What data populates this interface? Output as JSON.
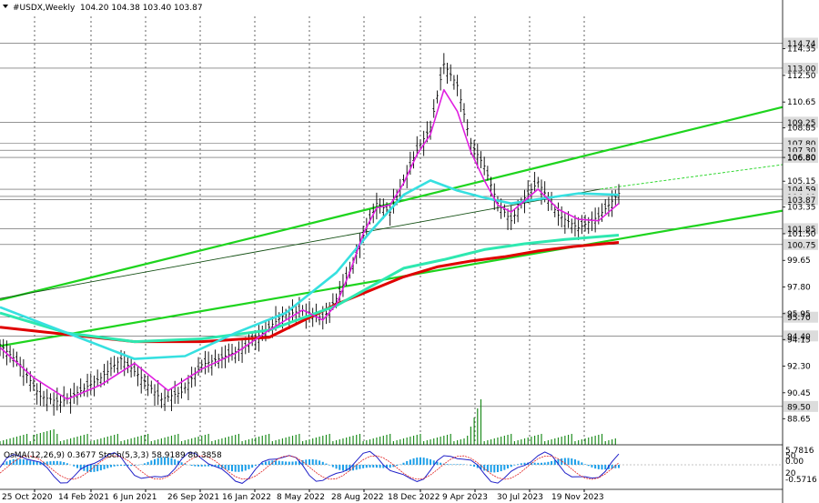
{
  "header": {
    "symbol": "#USDX,Weekly",
    "ohlc": "104.20 104.38 103.40 103.87"
  },
  "indicator": {
    "label": "OsMA(12,26,9) 0.3677  Stoch(5,3,3) 58.9189 80.3858",
    "axis_labels": [
      "5.7816",
      "50",
      "0.00",
      "20",
      "-0.5716"
    ]
  },
  "chart_data": {
    "type": "line",
    "title": "",
    "ylim": [
      86.9,
      116.6
    ],
    "y_ticks": [
      88.65,
      90.45,
      92.3,
      94.15,
      95.95,
      97.8,
      99.65,
      101.5,
      103.35,
      105.15,
      106.8,
      108.85,
      110.65,
      112.5,
      114.35
    ],
    "x_dates": [
      "25 Oct 2020",
      "14 Feb 2021",
      "6 Jun 2021",
      "26 Sep 2021",
      "16 Jan 2022",
      "8 May 2022",
      "28 Aug 2022",
      "18 Dec 2022",
      "9 Apr 2023",
      "30 Jul 2023",
      "19 Nov 2023"
    ],
    "levels": [
      {
        "value": 114.74,
        "label": "114.74"
      },
      {
        "value": 113.0,
        "label": "113.00"
      },
      {
        "value": 109.25,
        "label": "109.25"
      },
      {
        "value": 107.8,
        "label": "107.80"
      },
      {
        "value": 107.3,
        "label": "107.30"
      },
      {
        "value": 106.8,
        "label": "106.80"
      },
      {
        "value": 104.59,
        "label": "104.59"
      },
      {
        "value": 104.09,
        "label": "104.09"
      },
      {
        "value": 103.87,
        "label": "103.87"
      },
      {
        "value": 101.85,
        "label": "101.85"
      },
      {
        "value": 100.75,
        "label": "100.75"
      },
      {
        "value": 95.7,
        "label": "95.70"
      },
      {
        "value": 94.4,
        "label": "94.40"
      },
      {
        "value": 89.5,
        "label": "89.50"
      }
    ],
    "price": {
      "name": "#USDX",
      "x": [
        0,
        6,
        12,
        18,
        24,
        30,
        36,
        42,
        48,
        54,
        60,
        66,
        72,
        78,
        84,
        90,
        96,
        100,
        104,
        108,
        112,
        116,
        120,
        124,
        128,
        132,
        136,
        140,
        144,
        148,
        152,
        156,
        160,
        166,
        172,
        178,
        184
      ],
      "y": [
        93.8,
        92.4,
        90.2,
        89.8,
        90.6,
        91.5,
        92.8,
        91.5,
        90.0,
        90.5,
        92.4,
        92.9,
        93.5,
        94.6,
        95.8,
        96.2,
        95.6,
        97.0,
        98.9,
        101.4,
        103.6,
        103.0,
        105.2,
        107.3,
        108.9,
        113.3,
        111.8,
        107.8,
        106.2,
        103.6,
        102.4,
        104.0,
        105.1,
        102.8,
        101.9,
        102.7,
        104.3
      ]
    },
    "ma_magenta": {
      "x": [
        0,
        10,
        20,
        30,
        40,
        50,
        60,
        70,
        80,
        90,
        96,
        100,
        104,
        108,
        112,
        116,
        120,
        124,
        128,
        132,
        136,
        140,
        144,
        148,
        152,
        156,
        160,
        166,
        172,
        178,
        184
      ],
      "y": [
        93.6,
        91.5,
        90.0,
        91.0,
        92.5,
        90.6,
        92.1,
        93.2,
        94.8,
        96.2,
        95.5,
        96.6,
        98.8,
        101.5,
        103.3,
        103.5,
        105.0,
        107.0,
        108.4,
        111.5,
        110.0,
        107.2,
        105.2,
        103.5,
        103.0,
        103.8,
        104.6,
        103.2,
        102.5,
        102.4,
        103.6
      ]
    },
    "ma_cyan": {
      "x": [
        0,
        20,
        40,
        55,
        70,
        85,
        100,
        110,
        120,
        128,
        136,
        144,
        152,
        160,
        172,
        184
      ],
      "y": [
        96.4,
        94.6,
        92.8,
        93.0,
        94.6,
        96.0,
        98.8,
        101.6,
        104.2,
        105.2,
        104.5,
        104.0,
        103.6,
        103.9,
        104.3,
        104.2
      ]
    },
    "ma_teal": {
      "x": [
        0,
        20,
        40,
        60,
        80,
        100,
        120,
        132,
        144,
        156,
        168,
        184
      ],
      "y": [
        96.0,
        94.6,
        94.0,
        94.2,
        94.8,
        96.5,
        99.1,
        99.7,
        100.4,
        100.8,
        101.1,
        101.4
      ]
    },
    "ma_red": {
      "x": [
        0,
        20,
        40,
        60,
        80,
        100,
        120,
        130,
        140,
        150,
        160,
        170,
        184
      ],
      "y": [
        95.0,
        94.5,
        94.0,
        94.0,
        94.3,
        96.6,
        98.5,
        99.2,
        99.6,
        99.9,
        100.3,
        100.6,
        100.9
      ]
    }
  }
}
